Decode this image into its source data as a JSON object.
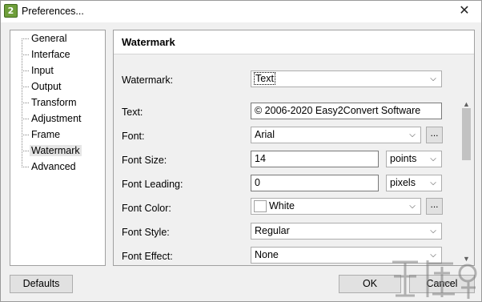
{
  "window": {
    "title": "Preferences...",
    "app_icon_glyph": "2",
    "close_glyph": "✕"
  },
  "tree": {
    "items": [
      {
        "label": "General"
      },
      {
        "label": "Interface"
      },
      {
        "label": "Input"
      },
      {
        "label": "Output"
      },
      {
        "label": "Transform"
      },
      {
        "label": "Adjustment"
      },
      {
        "label": "Frame"
      },
      {
        "label": "Watermark",
        "selected": true
      },
      {
        "label": "Advanced"
      }
    ]
  },
  "panel": {
    "title": "Watermark",
    "watermark": {
      "label": "Watermark:",
      "value": "Text"
    },
    "text": {
      "label": "Text:",
      "value": "© 2006-2020 Easy2Convert Software"
    },
    "font": {
      "label": "Font:",
      "value": "Arial",
      "browse": "..."
    },
    "font_size": {
      "label": "Font Size:",
      "value": "14",
      "unit": "points"
    },
    "font_leading": {
      "label": "Font Leading:",
      "value": "0",
      "unit": "pixels"
    },
    "font_color": {
      "label": "Font Color:",
      "value": "White",
      "swatch_color": "#ffffff",
      "browse": "..."
    },
    "font_style": {
      "label": "Font Style:",
      "value": "Regular"
    },
    "font_effect": {
      "label": "Font Effect:",
      "value": "None"
    }
  },
  "icons": {
    "combo_arrow": "chevron-down-icon",
    "scroll_up": "triangle-up-icon",
    "scroll_down": "triangle-down-icon"
  },
  "footer": {
    "defaults_label": "Defaults",
    "ok_label": "OK",
    "cancel_label": "Cancel"
  }
}
